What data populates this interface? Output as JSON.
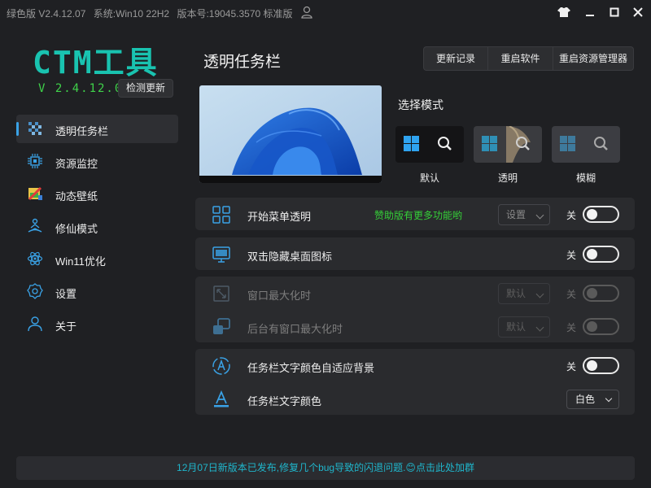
{
  "titlebar": {
    "edition": "绿色版 V2.4.12.07",
    "system": "系统:Win10 22H2",
    "build": "版本号:19045.3570 标准版"
  },
  "app": {
    "logo": "CTM工具",
    "version": "V 2.4.12.07",
    "check_update_label": "检测更新"
  },
  "sidebar": {
    "items": [
      {
        "label": "透明任务栏",
        "icon": "taskbar-checker-icon",
        "active": true
      },
      {
        "label": "资源监控",
        "icon": "chip-icon"
      },
      {
        "label": "动态壁纸",
        "icon": "wallpaper-icon"
      },
      {
        "label": "修仙模式",
        "icon": "meditation-icon"
      },
      {
        "label": "Win11优化",
        "icon": "atom-icon"
      },
      {
        "label": "设置",
        "icon": "gear-icon"
      },
      {
        "label": "关于",
        "icon": "person-icon"
      }
    ]
  },
  "main": {
    "title": "透明任务栏",
    "top_buttons": [
      "更新记录",
      "重启软件",
      "重启资源管理器"
    ],
    "mode_title": "选择模式",
    "modes": [
      {
        "label": "默认"
      },
      {
        "label": "透明"
      },
      {
        "label": "模糊"
      }
    ],
    "rows": {
      "start_menu": {
        "label": "开始菜单透明",
        "promo": "赞助版有更多功能哟",
        "select": "设置",
        "state": "关"
      },
      "hide_icons": {
        "label": "双击隐藏桌面图标",
        "state": "关"
      },
      "max_window": {
        "label": "窗口最大化时",
        "select": "默认",
        "state": "关"
      },
      "bg_max_window": {
        "label": "后台有窗口最大化时",
        "select": "默认",
        "state": "关"
      },
      "text_adapt": {
        "label": "任务栏文字颜色自适应背景",
        "state": "关"
      },
      "text_color": {
        "label": "任务栏文字颜色",
        "select": "白色"
      }
    }
  },
  "footer": {
    "text": "12月07日新版本已发布,修复几个bug导致的闪退问题.😊点击此处加群"
  },
  "colors": {
    "accent": "#3aa2e6",
    "logo": "#19c3b0",
    "version": "#3fd24a",
    "promo": "#35d038",
    "footer_text": "#1fb6cc"
  }
}
